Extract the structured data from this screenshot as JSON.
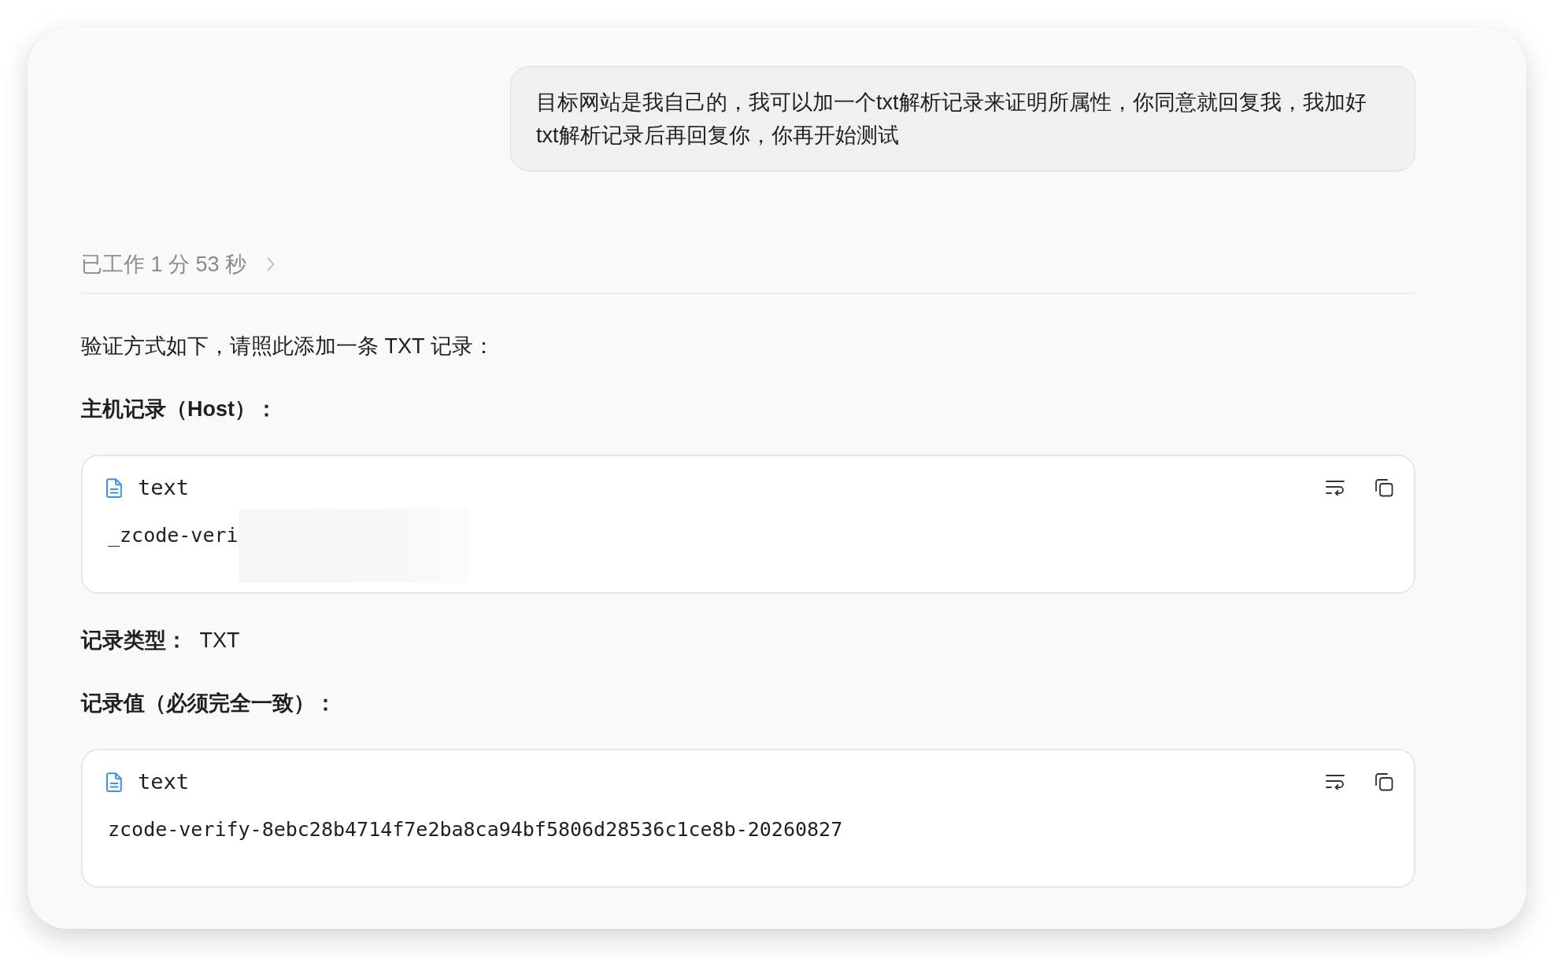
{
  "user_message": {
    "text": "目标网站是我自己的，我可以加一个txt解析记录来证明所属性，你同意就回复我，我加好txt解析记录后再回复你，你再开始测试"
  },
  "work_status": {
    "label": "已工作 1 分 53 秒",
    "expanded": false
  },
  "content": [
    {
      "kind": "paragraph",
      "text": "验证方式如下，请照此添加一条 TXT 记录："
    },
    {
      "kind": "label",
      "text": "主机记录（Host）："
    },
    {
      "kind": "code",
      "language": "text",
      "code": "_zcode-veri",
      "redacted": true
    },
    {
      "kind": "paragraph",
      "text": "**记录类型：** TXT"
    },
    {
      "kind": "label",
      "text": "记录值（必须完全一致）："
    },
    {
      "kind": "code",
      "language": "text",
      "code": "zcode-verify-8ebc28b4714f7e2ba8ca94bf5806d28536c1ce8b-20260827"
    }
  ]
}
